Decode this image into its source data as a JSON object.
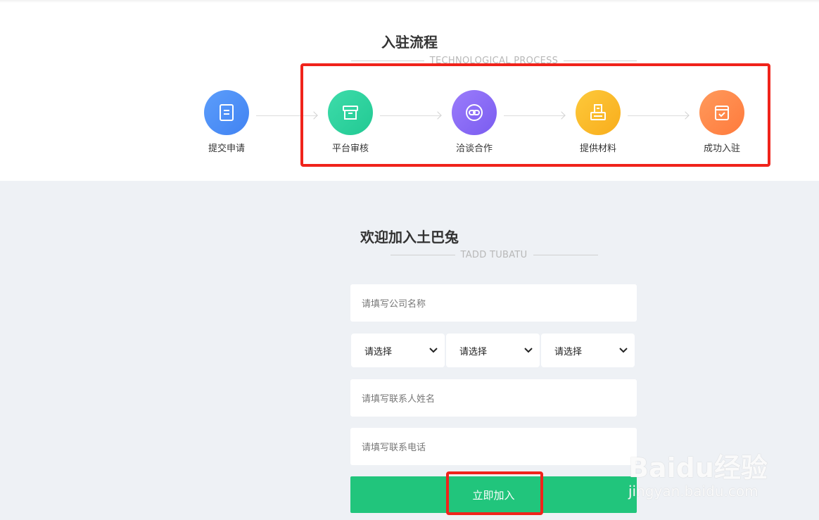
{
  "process": {
    "title": "入驻流程",
    "subtitle": "TECHNOLOGICAL PROCESS",
    "steps": [
      {
        "label": "提交申请",
        "icon": "document-icon",
        "color": "#4f8ff7"
      },
      {
        "label": "平台审核",
        "icon": "archive-box-icon",
        "color": "#2fd3a2"
      },
      {
        "label": "洽谈合作",
        "icon": "link-icon",
        "color": "#8b6ff6"
      },
      {
        "label": "提供材料",
        "icon": "printer-icon",
        "color": "#fbbc2b"
      },
      {
        "label": "成功入驻",
        "icon": "check-calendar-icon",
        "color": "#ff8a4a"
      }
    ]
  },
  "join": {
    "title": "欢迎加入土巴兔",
    "subtitle": "TADD TUBATU",
    "company_placeholder": "请填写公司名称",
    "selects": [
      "请选择",
      "请选择",
      "请选择"
    ],
    "contact_placeholder": "请填写联系人姓名",
    "phone_placeholder": "请填写联系电话",
    "submit_label": "立即加入"
  },
  "watermark": {
    "brand": "Baidu经验",
    "url": "jingyan.baidu.com"
  },
  "colors": {
    "highlight": "#f0231b",
    "submit": "#21c57c",
    "background": "#eef1f5"
  }
}
